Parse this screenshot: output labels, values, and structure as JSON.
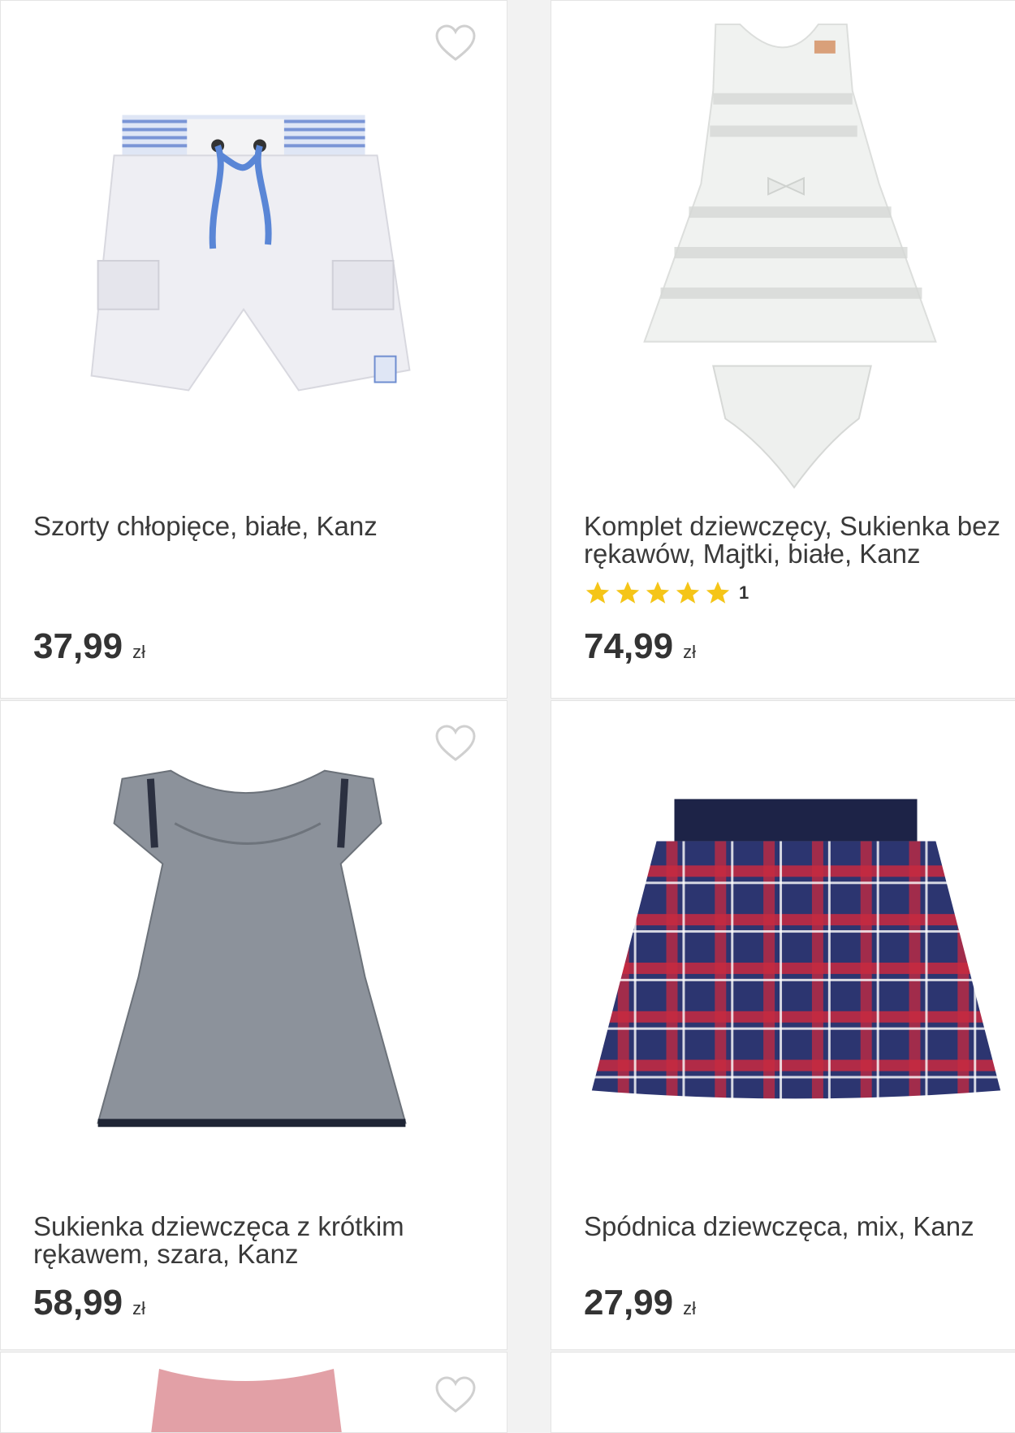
{
  "products": [
    {
      "title": "Szorty chłopięce, białe, Kanz",
      "price": "37,99",
      "currency": "zł",
      "image": "white-boys-shorts"
    },
    {
      "title": "Komplet dziewczęcy, Sukienka bez rękawów, Majtki, białe, Kanz",
      "price": "74,99",
      "currency": "zł",
      "rating": {
        "stars": 5,
        "count": "1"
      },
      "image": "white-dress-set"
    },
    {
      "title": "Sukienka dziewczęca z krótkim rękawem, szara, Kanz",
      "price": "58,99",
      "currency": "zł",
      "image": "grey-dress"
    },
    {
      "title": "Spódnica dziewczęca, mix, Kanz",
      "price": "27,99",
      "currency": "zł",
      "image": "plaid-skirt"
    }
  ],
  "icons": {
    "favorite": "heart-outline-icon",
    "rating": "star-icon"
  },
  "colors": {
    "star": "#f5c518",
    "heart": "#d0d0d0",
    "text": "#3a3a3a",
    "border": "#e4e4e4"
  }
}
